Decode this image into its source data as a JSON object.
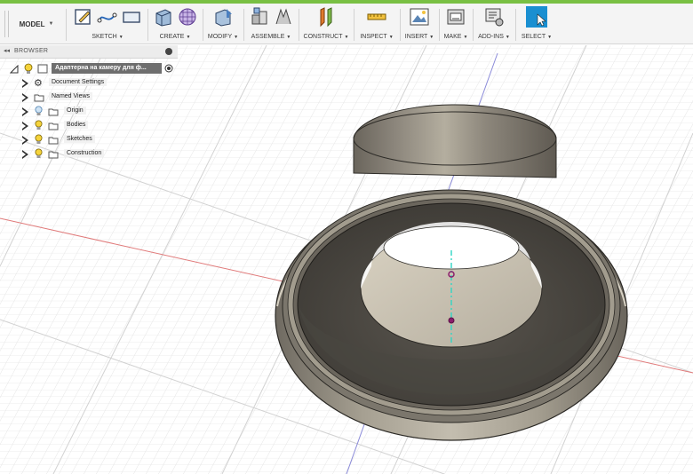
{
  "toolbar": {
    "model_label": "MODEL",
    "groups": [
      {
        "label": "SKETCH",
        "icons": [
          "create-sketch-icon",
          "spline-icon",
          "rectangle-icon"
        ]
      },
      {
        "label": "CREATE",
        "icons": [
          "extrude-icon",
          "form-icon"
        ]
      },
      {
        "label": "MODIFY",
        "icons": [
          "press-pull-icon"
        ]
      },
      {
        "label": "ASSEMBLE",
        "icons": [
          "new-component-icon",
          "joint-icon"
        ]
      },
      {
        "label": "CONSTRUCT",
        "icons": [
          "offset-plane-icon"
        ]
      },
      {
        "label": "INSPECT",
        "icons": [
          "measure-icon"
        ]
      },
      {
        "label": "INSERT",
        "icons": [
          "insert-image-icon"
        ]
      },
      {
        "label": "MAKE",
        "icons": [
          "3d-print-icon"
        ]
      },
      {
        "label": "ADD-INS",
        "icons": [
          "scripts-addins-icon"
        ]
      },
      {
        "label": "SELECT",
        "icons": [
          "select-cursor-icon"
        ]
      }
    ]
  },
  "browser": {
    "title": "BROWSER",
    "root_label": "Адаптерна на камеру  для ф...",
    "items": [
      {
        "label": "Document Settings",
        "icon": "gear-icon"
      },
      {
        "label": "Named Views",
        "icon": "folder-icon"
      },
      {
        "label": "Origin",
        "icon": "folder-icon"
      },
      {
        "label": "Bodies",
        "icon": "folder-icon"
      },
      {
        "label": "Sketches",
        "icon": "folder-icon"
      },
      {
        "label": "Construction",
        "icon": "folder-icon"
      }
    ]
  },
  "colors": {
    "accent": "#79c043",
    "select_active": "#1a8fd1",
    "model_body": "#6f6b62"
  }
}
